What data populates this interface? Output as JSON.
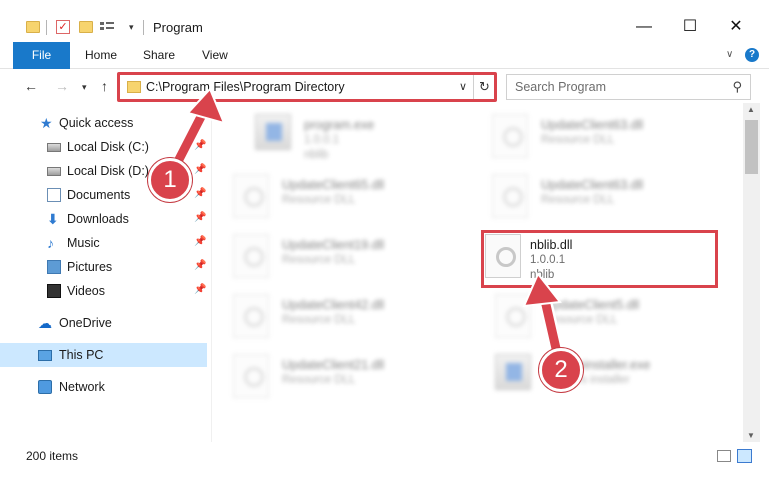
{
  "window": {
    "title": "Program",
    "minimize_glyph": "—",
    "maximize_glyph": "☐",
    "close_glyph": "✕"
  },
  "ribbon": {
    "tabs": [
      {
        "label": "File"
      },
      {
        "label": "Home"
      },
      {
        "label": "Share"
      },
      {
        "label": "View"
      }
    ],
    "help_glyph": "?"
  },
  "navbar": {
    "address": "C:\\Program Files\\Program Directory",
    "search_placeholder": "Search Program"
  },
  "navpane": {
    "items": [
      {
        "label": "Quick access",
        "icon": "star-icon",
        "pinned": false
      },
      {
        "label": "Local Disk (C:)",
        "icon": "drive-icon",
        "pinned": true
      },
      {
        "label": "Local Disk (D:)",
        "icon": "drive-icon",
        "pinned": true
      },
      {
        "label": "Documents",
        "icon": "documents-icon",
        "pinned": true
      },
      {
        "label": "Downloads",
        "icon": "download-icon",
        "pinned": true
      },
      {
        "label": "Music",
        "icon": "music-icon",
        "pinned": true
      },
      {
        "label": "Pictures",
        "icon": "pictures-icon",
        "pinned": true
      },
      {
        "label": "Videos",
        "icon": "videos-icon",
        "pinned": true
      },
      {
        "label": "OneDrive",
        "icon": "cloud-icon",
        "pinned": false
      },
      {
        "label": "This PC",
        "icon": "computer-icon",
        "pinned": false,
        "selected": true
      },
      {
        "label": "Network",
        "icon": "network-icon",
        "pinned": false
      }
    ]
  },
  "files": [
    {
      "name": "program.exe",
      "line1": "1.0.0.1",
      "line2": "nblib",
      "icon": "exe-icon",
      "blurred": true
    },
    {
      "name": "UpdateClient63.dll",
      "line1": "Resource DLL",
      "line2": "",
      "icon": "dll-icon",
      "blurred": true
    },
    {
      "name": "UpdateClient65.dll",
      "line1": "Resource DLL",
      "line2": "",
      "icon": "dll-icon",
      "blurred": true
    },
    {
      "name": "UpdateClient63.dll",
      "line1": "Resource DLL",
      "line2": "",
      "icon": "dll-icon",
      "blurred": true
    },
    {
      "name": "UpdateClient19.dll",
      "line1": "Resource DLL",
      "line2": "",
      "icon": "dll-icon",
      "blurred": true
    },
    {
      "name": "nblib.dll",
      "line1": "1.0.0.1",
      "line2": "nblib",
      "icon": "dll-icon",
      "blurred": false,
      "highlighted": true
    },
    {
      "name": "UpdateClient42.dll",
      "line1": "Resource DLL",
      "line2": "",
      "icon": "dll-icon",
      "blurred": true
    },
    {
      "name": "UpdateClient5.dll",
      "line1": "Resource DLL",
      "line2": "",
      "icon": "dll-icon",
      "blurred": true
    },
    {
      "name": "UpdateClient21.dll",
      "line1": "Resource DLL",
      "line2": "",
      "icon": "dll-icon",
      "blurred": true
    },
    {
      "name": "Updateinstaller.exe",
      "line1": "Updates installer",
      "line2": "",
      "icon": "exe-icon",
      "blurred": true
    }
  ],
  "status": {
    "item_count": "200 items"
  },
  "annotations": {
    "step1": "1",
    "step2": "2",
    "color": "#d9434c"
  }
}
